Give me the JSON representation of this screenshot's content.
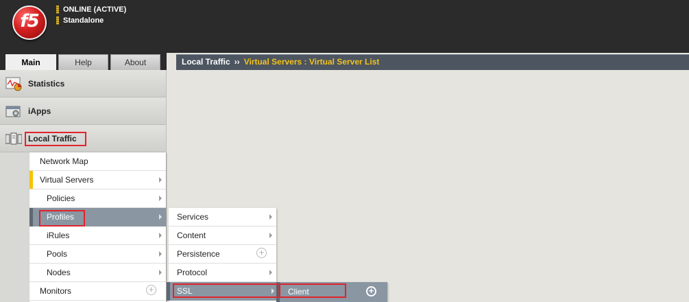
{
  "header": {
    "logo_text": "f5",
    "status_online": "ONLINE (ACTIVE)",
    "status_mode": "Standalone"
  },
  "tabs": [
    {
      "label": "Main",
      "active": true
    },
    {
      "label": "Help",
      "active": false
    },
    {
      "label": "About",
      "active": false
    }
  ],
  "breadcrumb": {
    "section": "Local Traffic",
    "separator": "››",
    "current": "Virtual Servers : Virtual Server List"
  },
  "sidebar": {
    "sections": [
      {
        "label": "Statistics",
        "icon": "statistics-icon"
      },
      {
        "label": "iApps",
        "icon": "iapps-icon"
      },
      {
        "label": "Local Traffic",
        "icon": "local-traffic-icon"
      }
    ]
  },
  "menu_local_traffic": {
    "items": [
      {
        "label": "Network Map"
      },
      {
        "label": "Virtual Servers"
      },
      {
        "label": "Policies"
      },
      {
        "label": "Profiles"
      },
      {
        "label": "iRules"
      },
      {
        "label": "Pools"
      },
      {
        "label": "Nodes"
      },
      {
        "label": "Monitors"
      }
    ]
  },
  "menu_profiles": {
    "items": [
      {
        "label": "Services"
      },
      {
        "label": "Content"
      },
      {
        "label": "Persistence"
      },
      {
        "label": "Protocol"
      },
      {
        "label": "SSL"
      }
    ]
  },
  "menu_ssl": {
    "items": [
      {
        "label": "Client"
      }
    ]
  },
  "colors": {
    "header_bg": "#2b2b2b",
    "breadcrumb_current": "#f2c21b",
    "selected_item": "#8a96a2",
    "highlight_box": "#e0232c",
    "active_marker": "#f5c400"
  }
}
